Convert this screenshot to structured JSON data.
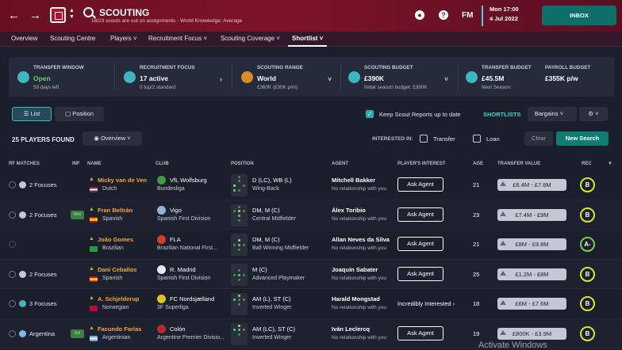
{
  "header": {
    "title": "SCOUTING",
    "subtitle": "18/23 scouts are out on assignments - World Knowledge: Average",
    "date_day": "Mon 17:00",
    "date_date": "4 Jul 2022",
    "inbox_label": "INBOX",
    "fm_label": "FM"
  },
  "tabs": [
    "Overview",
    "Scouting Centre",
    "Players",
    "Recruitment Focus",
    "Scouting Coverage",
    "Shortlist"
  ],
  "info": {
    "transfer_window_label": "TRANSFER WINDOW",
    "transfer_window_value": "Open",
    "transfer_window_sub": "59 days left",
    "recruitment_label": "RECRUITMENT FOCUS",
    "recruitment_value": "17 active",
    "recruitment_sub": "0 top/2 standard",
    "range_label": "SCOUTING RANGE",
    "range_value": "World",
    "range_sub": "£360K (£30K p/m)",
    "budget_label": "SCOUTING BUDGET",
    "budget_value": "£390K",
    "budget_sub": "Initial season budget: £390K",
    "transfer_budget_label": "TRANSFER BUDGET",
    "transfer_budget_value": "£45.5M",
    "payroll_label": "PAYROLL BUDGET",
    "payroll_value": "£355K p/w",
    "next_season": "Next Season:"
  },
  "toolbar": {
    "list_label": "List",
    "position_label": "Position",
    "keep_reports": "Keep Scout Reports up to date",
    "shortlists": "SHORTLISTS",
    "bargains": "Bargains",
    "players_found": "25 PLAYERS FOUND",
    "overview_label": "Overview",
    "interested_in": "INTERESTED IN:",
    "transfer": "Transfer",
    "loan": "Loan",
    "clear": "Clear",
    "new_search": "New Search"
  },
  "columns": [
    "RF MATCHES",
    "INF",
    "NAME",
    "CLUB",
    "POSITION",
    "AGENT",
    "PLAYER'S INTEREST",
    "AGE",
    "TRANSFER VALUE",
    "REC"
  ],
  "players": [
    {
      "rf": "2 Focuses",
      "inf": "",
      "name": "Micky van de Ven",
      "nat": "Dutch",
      "club": "VfL Wolfsburg",
      "league": "Bundesliga",
      "pos": "D (LC), WB (L)",
      "role": "Wing-Back",
      "agent": "Mitchell Bakker",
      "agent_rel": "No relationship with you",
      "interest": "Ask Agent",
      "age": "21",
      "value": "£6.4M - £7.8M",
      "rec": "B"
    },
    {
      "rf": "2 Focuses",
      "inf": "Wnt",
      "name": "Fran Beltrán",
      "nat": "Spanish",
      "club": "Vigo",
      "league": "Spanish First Division",
      "pos": "DM, M (C)",
      "role": "Central Midfielder",
      "agent": "Álex Toribio",
      "agent_rel": "No relationship with you",
      "interest": "Ask Agent",
      "age": "23",
      "value": "£7.4M - £9M",
      "rec": "B"
    },
    {
      "rf": "",
      "inf": "",
      "name": "João Gomes",
      "nat": "Brazilian",
      "club": "FLA",
      "league": "Brazilian National First...",
      "pos": "DM, M (C)",
      "role": "Ball Winning Midfielder",
      "agent": "Allan Neves da Silva",
      "agent_rel": "No relationship with you",
      "interest": "Ask Agent",
      "age": "21",
      "value": "£8M - £9.8M",
      "rec": "A-"
    },
    {
      "rf": "2 Focuses",
      "inf": "",
      "name": "Dani Ceballos",
      "nat": "Spanish",
      "club": "R. Madrid",
      "league": "Spanish First Division",
      "pos": "M (C)",
      "role": "Advanced Playmaker",
      "agent": "Joaquín Sabater",
      "agent_rel": "No relationship with you",
      "interest": "Ask Agent",
      "age": "25",
      "value": "£1.2M - £8M",
      "rec": "B"
    },
    {
      "rf": "3 Focuses",
      "inf": "",
      "name": "A. Schjelderup",
      "nat": "Norwegian",
      "club": "FC Nordsjælland",
      "league": "3F Superliga",
      "pos": "AM (L), ST (C)",
      "role": "Inverted Winger",
      "agent": "Harald Mongstad",
      "agent_rel": "No relationship with you",
      "interest": "Incredibly Interested",
      "age": "18",
      "value": "£6M - £7.6M",
      "rec": "B"
    },
    {
      "rf": "Argentina",
      "inf": "Sel",
      "name": "Facundo Farías",
      "nat": "Argentinian",
      "club": "Colón",
      "league": "Argentine Premier Divisio...",
      "pos": "AM (LC), ST (C)",
      "role": "Inverted Winger",
      "agent": "Iván Leclercq",
      "agent_rel": "No relationship with you",
      "interest": "Ask Agent",
      "age": "19",
      "value": "£800K - £3.9M",
      "rec": "B"
    }
  ],
  "watermark": "Activate Windows"
}
